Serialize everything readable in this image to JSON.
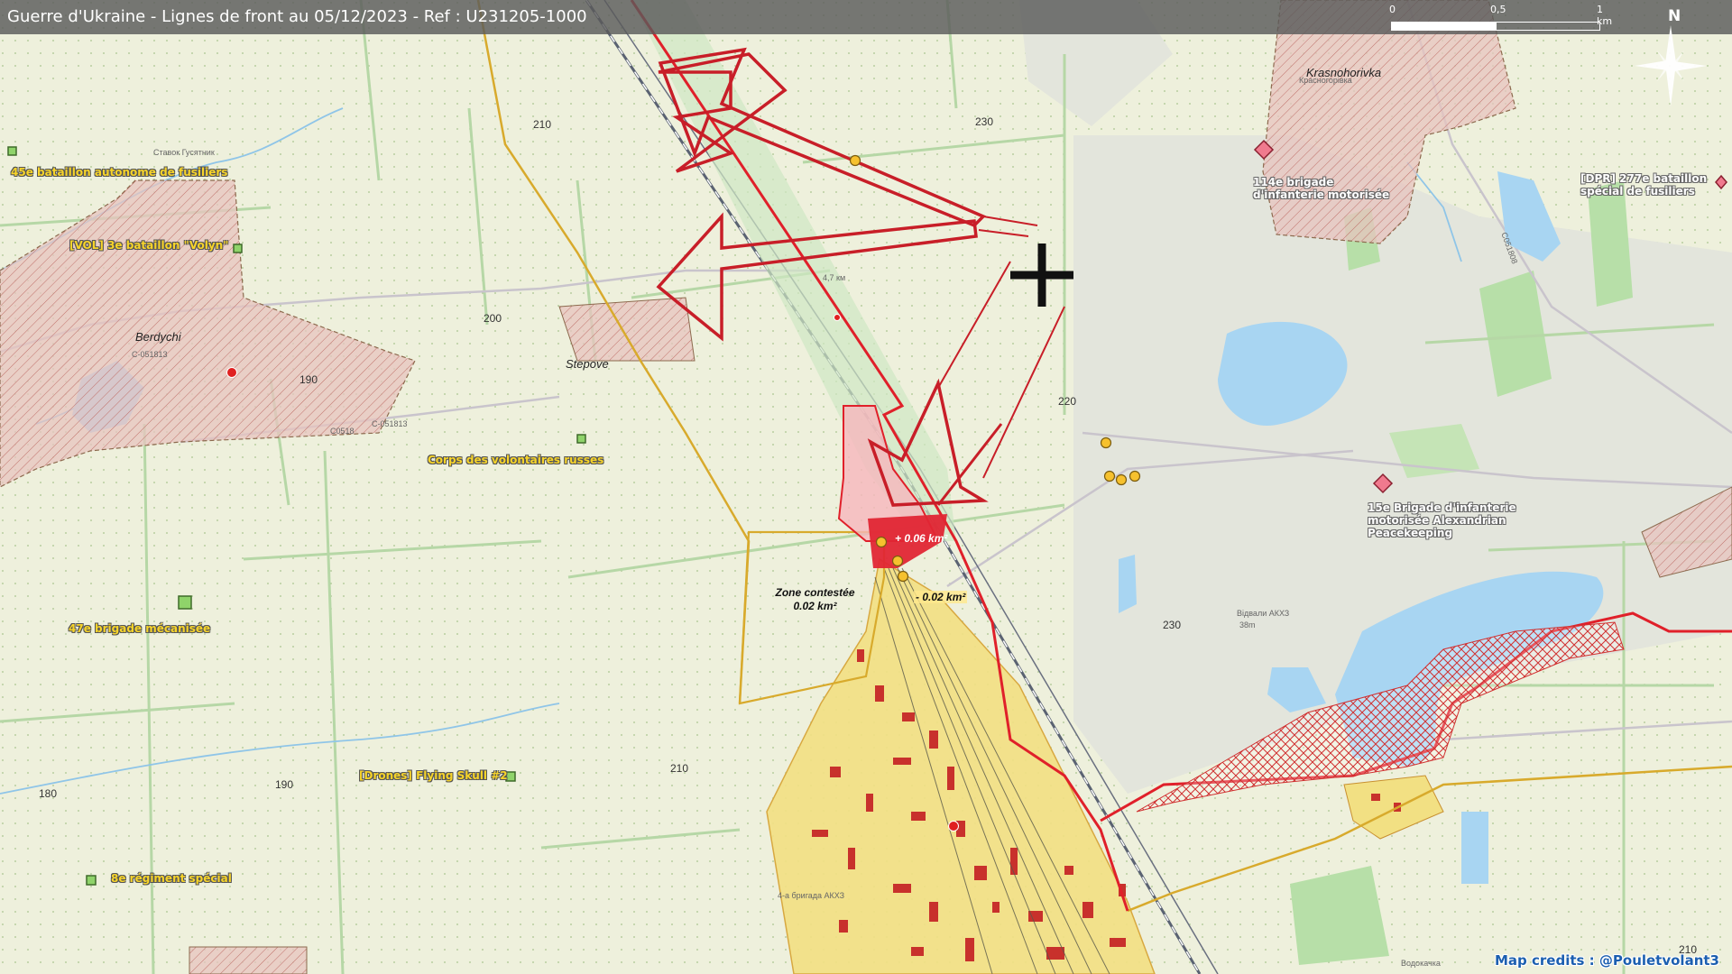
{
  "header": {
    "title": "Guerre d'Ukraine - Lignes de front au 05/12/2023 - Ref : U231205-1000"
  },
  "scale_bar": {
    "ticks": [
      "0",
      "0,5",
      "1 km"
    ]
  },
  "north_arrow": {
    "label": "N",
    "icon": "compass-rose-icon"
  },
  "colors": {
    "front_line": "#e0202a",
    "russian_area": "#e2c0bc",
    "occupied_area": "#f2e083",
    "water": "#a8d5f2",
    "ukrainian_unit": "#8fd36a",
    "russian_unit": "#f07a8e",
    "unit_label": "#f7d42a"
  },
  "towns": [
    {
      "id": "berdychi",
      "name": "Berdychi"
    },
    {
      "id": "stepove",
      "name": "Stepove"
    },
    {
      "id": "krasnohorivka",
      "name": "Krasnohorivka"
    }
  ],
  "elevations": [
    "210",
    "200",
    "190",
    "230",
    "220",
    "230",
    "210",
    "190",
    "180",
    "210"
  ],
  "map_small_labels": {
    "berdychi_road": "C-051813",
    "stepove_road": "C-051813",
    "road_c0518": "C0518",
    "stavok": "Ставок Гусятник",
    "rail_km": "4,7 км",
    "road_c051808": "C051808",
    "spoil_heap": "Відвали АКХЗ",
    "spoil_heap_height": "38m",
    "town_name_cyr": "Красногорівка",
    "south_label": "Водокачка",
    "plant_label": "4-а бригада АКХЗ"
  },
  "ukrainian_units": [
    {
      "id": "u45",
      "name": "45e bataillon autonome de fusiliers",
      "icon": "infantry-battalion-icon"
    },
    {
      "id": "volyn",
      "name": "[VOL] 3e bataillon \"Volyn\"",
      "icon": "infantry-battalion-icon"
    },
    {
      "id": "rdk",
      "name": "Corps des volontaires russes",
      "icon": "unit-icon"
    },
    {
      "id": "u47",
      "name": "47e brigade mécanisée",
      "icon": "mechanized-brigade-icon"
    },
    {
      "id": "drones",
      "name": "[Drones] Flying Skull #2",
      "icon": "drone-unit-icon"
    },
    {
      "id": "u8",
      "name": "8e régiment spécial",
      "icon": "regiment-icon"
    }
  ],
  "russian_units": [
    {
      "id": "r114",
      "name": "114e brigade d'infanterie motorisée",
      "icon": "brigade-diamond-icon"
    },
    {
      "id": "r277",
      "name": "[DPR] 277e bataillon spécial de fusiliers",
      "icon": "battalion-diamond-icon"
    },
    {
      "id": "r15",
      "name": "15e Brigade d'infanterie motorisée Alexandrian Peacekeeping",
      "icon": "brigade-diamond-icon"
    }
  ],
  "zones": {
    "contested_title": "Zone contestée",
    "contested_area": "0.02 km²",
    "gain": "+ 0.06 km²",
    "loss": "- 0.02 km²"
  },
  "credits": "Map credits : @Pouletvolant3"
}
